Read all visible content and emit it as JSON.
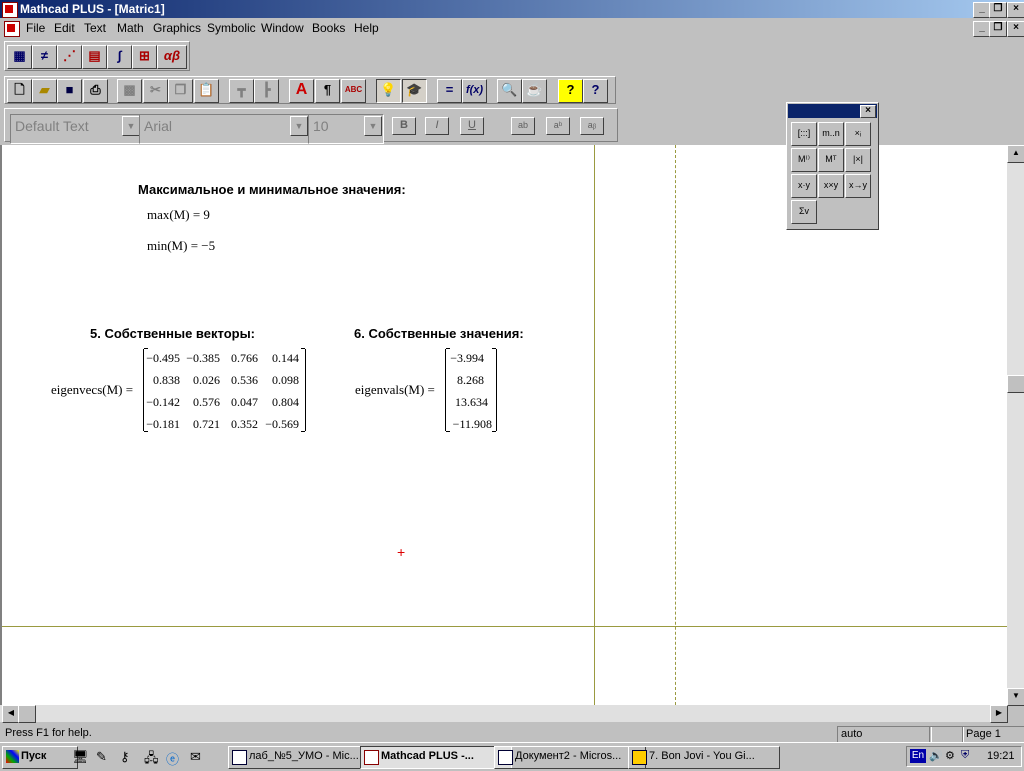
{
  "window": {
    "title": "Mathcad PLUS - [Matric1]"
  },
  "menu": [
    "File",
    "Edit",
    "Text",
    "Math",
    "Graphics",
    "Symbolic",
    "Window",
    "Books",
    "Help"
  ],
  "format_bar": {
    "style": "Default Text",
    "font": "Arial",
    "size": "10",
    "bold": "B",
    "italic": "I",
    "underline": "U"
  },
  "toolbar2_glyphs": {
    "text_a": "A",
    "para": "¶",
    "spell": "ABC",
    "eq": "=",
    "fx": "f(x)",
    "help": "?"
  },
  "palette_buttons": [
    "[:::]",
    "m..n",
    "×ᵢ",
    "M⁽⁾",
    "Mᵀ",
    "|×|",
    "x·y",
    "x×y",
    "x→y",
    "Σv"
  ],
  "doc": {
    "heading_minmax": "Максимальное и минимальное значения:",
    "max_expr": "max(M) = 9",
    "min_expr": "min(M) = −5",
    "heading_vecs": "5. Собственные векторы:",
    "heading_vals": "6. Собственные значения:",
    "eigenvecs_label": "eigenvecs(M) =",
    "eigenvals_label": "eigenvals(M) =",
    "eigenvecs": [
      [
        "−0.495",
        "−0.385",
        "0.766",
        "0.144"
      ],
      [
        "0.838",
        "0.026",
        "0.536",
        "0.098"
      ],
      [
        "−0.142",
        "0.576",
        "0.047",
        "0.804"
      ],
      [
        "−0.181",
        "0.721",
        "0.352",
        "−0.569"
      ]
    ],
    "eigenvals": [
      "−3.994",
      "8.268",
      "13.634",
      "−11.908"
    ]
  },
  "status": {
    "help": "Press F1 for help.",
    "mode": "auto",
    "page": "Page 1"
  },
  "taskbar": {
    "start": "Пуск",
    "tasks": [
      "лаб_№5_УМО - Mic...",
      "Mathcad PLUS -...",
      "Документ2 - Micros...",
      "7. Bon Jovi - You Gi..."
    ],
    "lang": "En",
    "clock": "19:21"
  }
}
